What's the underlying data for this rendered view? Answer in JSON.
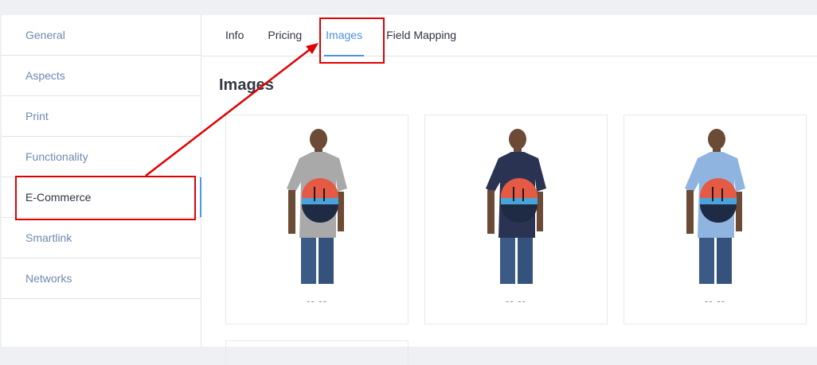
{
  "sidebar": {
    "items": [
      {
        "label": "General"
      },
      {
        "label": "Aspects"
      },
      {
        "label": "Print"
      },
      {
        "label": "Functionality"
      },
      {
        "label": "E-Commerce",
        "active": true
      },
      {
        "label": "Smartlink"
      },
      {
        "label": "Networks"
      }
    ]
  },
  "tabs": [
    {
      "label": "Info"
    },
    {
      "label": "Pricing"
    },
    {
      "label": "Images",
      "active": true
    },
    {
      "label": "Field Mapping"
    }
  ],
  "section": {
    "title": "Images"
  },
  "images": [
    {
      "caption": "-- --",
      "shirt_color": "#a9a9a9"
    },
    {
      "caption": "-- --",
      "shirt_color": "#2b3352"
    },
    {
      "caption": "-- --",
      "shirt_color": "#8fb4e0"
    }
  ],
  "colors": {
    "accent": "#4a90e2",
    "highlight": "#e00000"
  }
}
